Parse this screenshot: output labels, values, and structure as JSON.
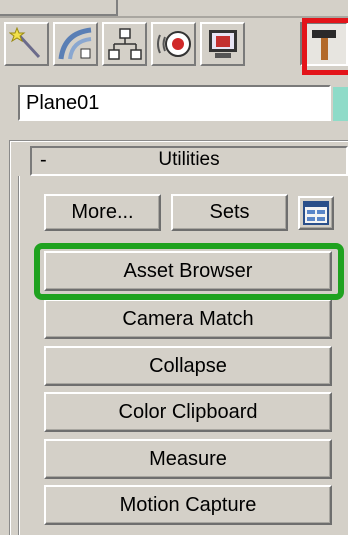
{
  "toolbar": {
    "tabs": [
      {
        "name": "create-tab",
        "icon": "wand-icon"
      },
      {
        "name": "modify-tab",
        "icon": "modify-curve-icon"
      },
      {
        "name": "hierarchy-tab",
        "icon": "hierarchy-icon"
      },
      {
        "name": "motion-tab",
        "icon": "motion-icon"
      },
      {
        "name": "display-tab",
        "icon": "display-monitor-icon"
      },
      {
        "name": "utilities-tab",
        "icon": "hammer-icon",
        "active": true
      }
    ]
  },
  "object_name": {
    "value": "Plane01"
  },
  "object_color": "#8fdbc8",
  "highlight_colors": {
    "red": "#e3141a",
    "green": "#1fa21f"
  },
  "rollout": {
    "toggle": "-",
    "title": "Utilities"
  },
  "utilities_row": {
    "more_label": "More...",
    "sets_label": "Sets"
  },
  "utility_buttons": [
    {
      "label": "Asset Browser"
    },
    {
      "label": "Camera Match"
    },
    {
      "label": "Collapse"
    },
    {
      "label": "Color Clipboard"
    },
    {
      "label": "Measure"
    },
    {
      "label": "Motion Capture"
    }
  ]
}
